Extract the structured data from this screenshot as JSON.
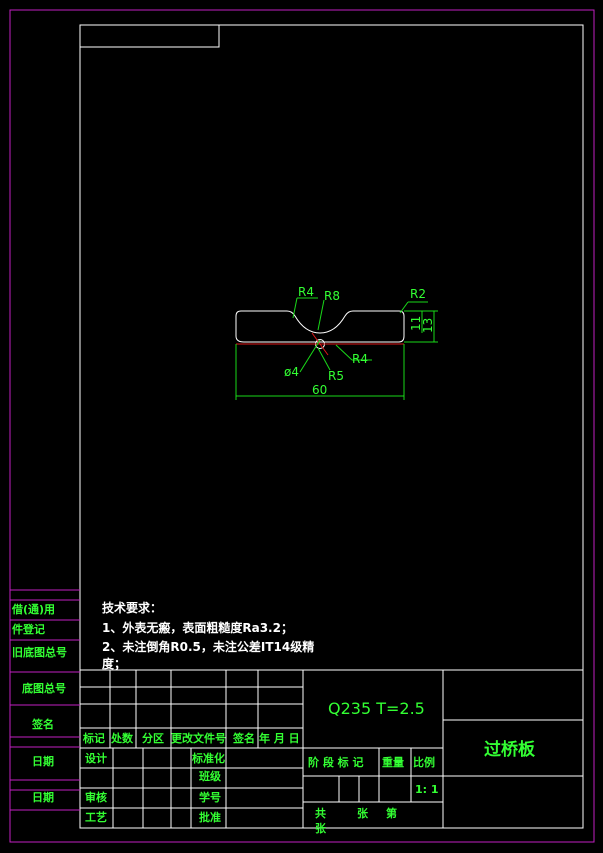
{
  "colors": {
    "frame": "#c21fc2",
    "border": "#ffffff",
    "dimension": "#19d919",
    "centerline": "#e01919",
    "text": "#33ff33",
    "background": "#000000"
  },
  "dimensions": {
    "r4_top": "R4",
    "r8": "R8",
    "r2": "R2",
    "d11": "11",
    "d13": "13",
    "dia4": "ø4",
    "r5": "R5",
    "r4_bottom": "R4",
    "width": "60"
  },
  "notes": {
    "title": "技术要求：",
    "line1": "1、外表无瘢，表面粗糙度Ra3.2；",
    "line2": "2、未注倒角R0.5，未注公差IT14级精",
    "line3": "度；"
  },
  "side_labels": {
    "borrow": "借(通)用",
    "register": "件登记",
    "old_drawing": "旧底图总号",
    "drawing_no": "底图总号",
    "signature": "签名",
    "date1": "日期",
    "date2": "日期"
  },
  "title_block": {
    "material": "Q235   T=2.5",
    "part_name": "过桥板",
    "header_row": [
      "标记",
      "处数",
      "分区",
      "更改文件号",
      "签名",
      "年 月 日"
    ],
    "design": "设计",
    "standardize": "标准化",
    "check": "审核",
    "craft": "工艺",
    "grade": "班级",
    "student_no": "学号",
    "approve": "批准",
    "stage_mark": "阶 段 标 记",
    "weight": "重量",
    "scale": "比例",
    "scale_value": "1: 1",
    "total": "共",
    "sheets": "张",
    "sheet_no": "第",
    "sheet_unit": "张"
  }
}
